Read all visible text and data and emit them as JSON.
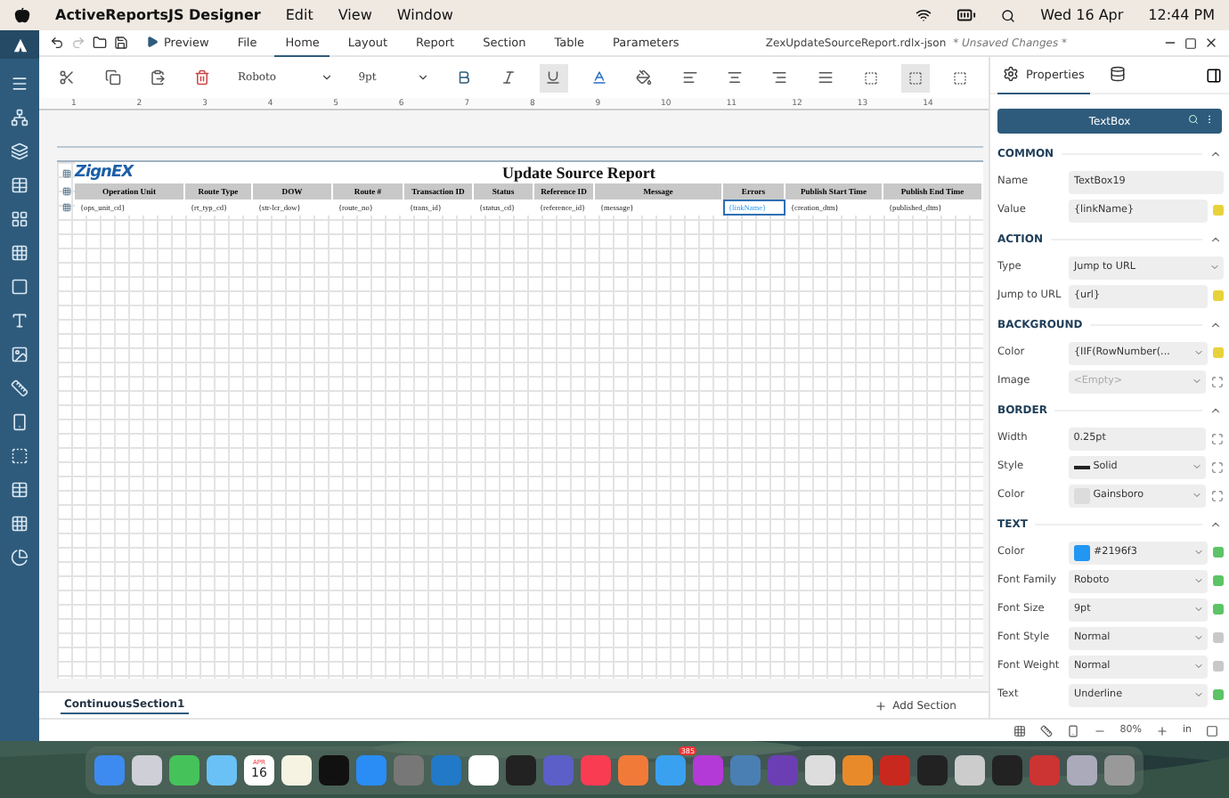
{
  "menubar": {
    "app_name": "ActiveReportsJS Designer",
    "menus": [
      "Edit",
      "View",
      "Window"
    ],
    "date": "Wed 16 Apr",
    "time": "12:44 PM"
  },
  "tabs": [
    {
      "label": "Preview",
      "kind": "action",
      "selected": false
    },
    {
      "label": "File",
      "kind": "tab",
      "selected": false
    },
    {
      "label": "Home",
      "kind": "tab",
      "selected": true
    },
    {
      "label": "Layout",
      "kind": "tab",
      "selected": false
    },
    {
      "label": "Report",
      "kind": "tab",
      "selected": false
    },
    {
      "label": "Section",
      "kind": "tab",
      "selected": false
    },
    {
      "label": "Table",
      "kind": "tab",
      "selected": false
    },
    {
      "label": "Parameters",
      "kind": "tab",
      "selected": false
    }
  ],
  "document": {
    "file_name": "ZexUpdateSourceReport.rdlx-json",
    "status": "* Unsaved Changes *"
  },
  "ribbon": {
    "font": "Roboto",
    "size": "9pt",
    "toggles": [
      {
        "kind": "bold",
        "selected": false
      },
      {
        "kind": "italic",
        "selected": false
      },
      {
        "kind": "underline",
        "selected": true
      }
    ],
    "box_styles": [
      {
        "selected": false
      },
      {
        "selected": true
      },
      {
        "selected": false
      }
    ]
  },
  "ruler": [
    "1",
    "2",
    "3",
    "4",
    "5",
    "6",
    "7",
    "8",
    "9",
    "10",
    "11",
    "12",
    "13",
    "14"
  ],
  "report": {
    "logo": "ZignEX",
    "title": "Update Source Report",
    "columns": [
      {
        "header": "Operation Unit",
        "field": "{ops_unit_cd}",
        "selected": false
      },
      {
        "header": "Route Type",
        "field": "{rt_typ_cd}",
        "selected": false
      },
      {
        "header": "DOW",
        "field": "{str-lcr_dow}",
        "selected": false
      },
      {
        "header": "Route #",
        "field": "{route_no}",
        "selected": false
      },
      {
        "header": "Transaction ID",
        "field": "{trans_id}",
        "selected": false
      },
      {
        "header": "Status",
        "field": "{status_cd}",
        "selected": false
      },
      {
        "header": "Reference ID",
        "field": "{reference_id}",
        "selected": false
      },
      {
        "header": "Message",
        "field": "{message}",
        "selected": false
      },
      {
        "header": "Errors",
        "field": "{linkName}",
        "selected": true
      },
      {
        "header": "Publish Start Time",
        "field": "{creation_dtm}",
        "selected": false
      },
      {
        "header": "Publish End Time",
        "field": "{published_dtm}",
        "selected": false
      }
    ]
  },
  "properties": {
    "tabs": [
      {
        "kind": "properties",
        "label": "Properties",
        "selected": true
      },
      {
        "kind": "data",
        "selected": false
      }
    ],
    "element": "TextBox",
    "sections": [
      {
        "title": "COMMON",
        "rows": [
          {
            "label": "Name",
            "kind": "input",
            "value": "TextBox19"
          },
          {
            "label": "Value",
            "kind": "input",
            "value": "{linkName}",
            "flag": {
              "color": "#e8d23c"
            }
          }
        ]
      },
      {
        "title": "ACTION",
        "rows": [
          {
            "label": "Type",
            "kind": "select",
            "value": "Jump to URL"
          },
          {
            "label": "Jump to URL",
            "kind": "input",
            "value": "{url}",
            "flag": {
              "color": "#e8d23c"
            }
          }
        ]
      },
      {
        "title": "BACKGROUND",
        "rows": [
          {
            "label": "Color",
            "kind": "select",
            "value": "{IIF(RowNumber(...",
            "flag": {
              "color": "#e8d23c"
            }
          },
          {
            "label": "Image",
            "kind": "select",
            "placeholder": "<Empty>",
            "expand": true
          }
        ]
      },
      {
        "title": "BORDER",
        "rows": [
          {
            "label": "Width",
            "kind": "input",
            "value": "0.25pt",
            "expand": true
          },
          {
            "label": "Style",
            "kind": "line",
            "value": "Solid",
            "expand": true
          },
          {
            "label": "Color",
            "kind": "swatch",
            "swatch": {
              "color": "#dcdcdc"
            },
            "value": "Gainsboro",
            "expand": true
          }
        ]
      },
      {
        "title": "TEXT",
        "rows": [
          {
            "label": "Color",
            "kind": "swatch",
            "swatch": {
              "color": "#2196f3"
            },
            "value": "#2196f3",
            "flag": {
              "color": "#5cc466"
            }
          },
          {
            "label": "Font Family",
            "kind": "select",
            "value": "Roboto",
            "flag": {
              "color": "#5cc466"
            }
          },
          {
            "label": "Font Size",
            "kind": "select",
            "value": "9pt",
            "flag": {
              "color": "#5cc466"
            }
          },
          {
            "label": "Font Style",
            "kind": "select",
            "value": "Normal",
            "flag": {
              "color": "#c8c8c8"
            }
          },
          {
            "label": "Font Weight",
            "kind": "select",
            "value": "Normal",
            "flag": {
              "color": "#c8c8c8"
            }
          },
          {
            "label": "Text",
            "kind": "select",
            "value": "Underline",
            "flag": {
              "color": "#5cc466"
            }
          }
        ]
      }
    ]
  },
  "section_tabs": [
    {
      "label": "ContinuousSection1",
      "selected": true
    }
  ],
  "add_section": "Add Section",
  "status": {
    "zoom": "80%",
    "unit": "in"
  },
  "dock": {
    "calendar_month": "APR",
    "calendar_day": "16",
    "mail_badge": "385"
  }
}
